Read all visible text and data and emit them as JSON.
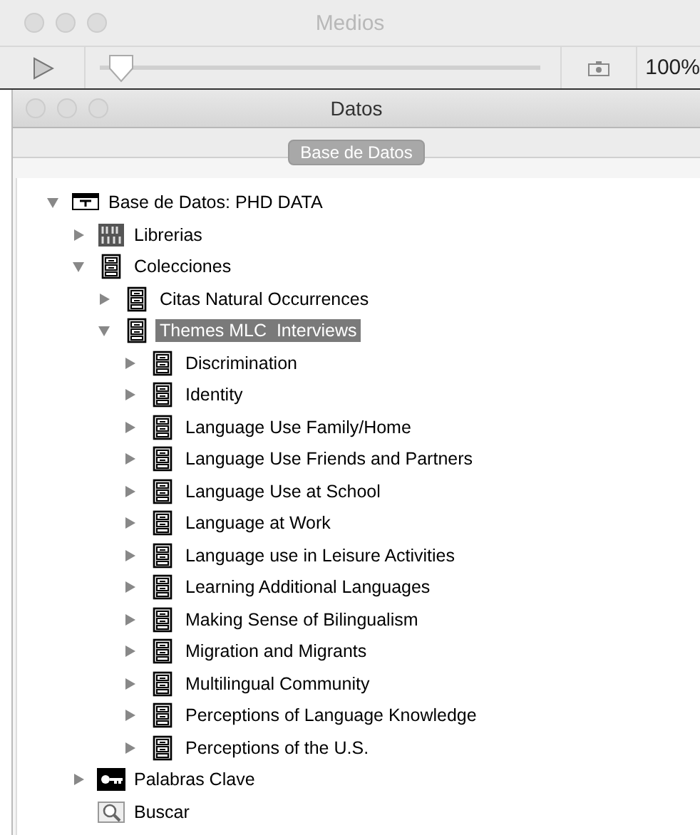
{
  "media_window": {
    "title": "Medios",
    "slider": {
      "level": 0.02
    },
    "zoom": "100%"
  },
  "data_window": {
    "title": "Datos",
    "tabs": [
      {
        "label": "Base de Datos",
        "selected": true
      }
    ],
    "tree": [
      {
        "label": "Base de Datos: PHD DATA",
        "kind": "database",
        "expanded": true,
        "selected": false,
        "children": [
          {
            "label": "Librerias",
            "kind": "library",
            "expanded": false,
            "selected": false
          },
          {
            "label": "Colecciones",
            "kind": "cabinet",
            "expanded": true,
            "selected": false,
            "children": [
              {
                "label": "Citas Natural Occurrences",
                "kind": "cabinet",
                "expanded": false,
                "selected": false
              },
              {
                "label": "Themes MLC  Interviews",
                "kind": "cabinet",
                "expanded": true,
                "selected": true,
                "children": [
                  {
                    "label": "Discrimination",
                    "kind": "cabinet",
                    "expanded": false,
                    "selected": false
                  },
                  {
                    "label": "Identity",
                    "kind": "cabinet",
                    "expanded": false,
                    "selected": false
                  },
                  {
                    "label": "Language Use Family/Home",
                    "kind": "cabinet",
                    "expanded": false,
                    "selected": false
                  },
                  {
                    "label": "Language Use Friends and Partners",
                    "kind": "cabinet",
                    "expanded": false,
                    "selected": false
                  },
                  {
                    "label": "Language Use at School",
                    "kind": "cabinet",
                    "expanded": false,
                    "selected": false
                  },
                  {
                    "label": "Language at Work",
                    "kind": "cabinet",
                    "expanded": false,
                    "selected": false
                  },
                  {
                    "label": "Language use in Leisure Activities",
                    "kind": "cabinet",
                    "expanded": false,
                    "selected": false
                  },
                  {
                    "label": "Learning Additional Languages",
                    "kind": "cabinet",
                    "expanded": false,
                    "selected": false
                  },
                  {
                    "label": "Making Sense of Bilingualism",
                    "kind": "cabinet",
                    "expanded": false,
                    "selected": false
                  },
                  {
                    "label": "Migration and Migrants",
                    "kind": "cabinet",
                    "expanded": false,
                    "selected": false
                  },
                  {
                    "label": "Multilingual Community",
                    "kind": "cabinet",
                    "expanded": false,
                    "selected": false
                  },
                  {
                    "label": "Perceptions of Language Knowledge",
                    "kind": "cabinet",
                    "expanded": false,
                    "selected": false
                  },
                  {
                    "label": "Perceptions of the U.S.",
                    "kind": "cabinet",
                    "expanded": false,
                    "selected": false
                  }
                ]
              }
            ]
          },
          {
            "label": "Palabras Clave",
            "kind": "keys",
            "expanded": false,
            "selected": false
          },
          {
            "label": "Buscar",
            "kind": "search",
            "selected": false
          }
        ]
      }
    ]
  }
}
